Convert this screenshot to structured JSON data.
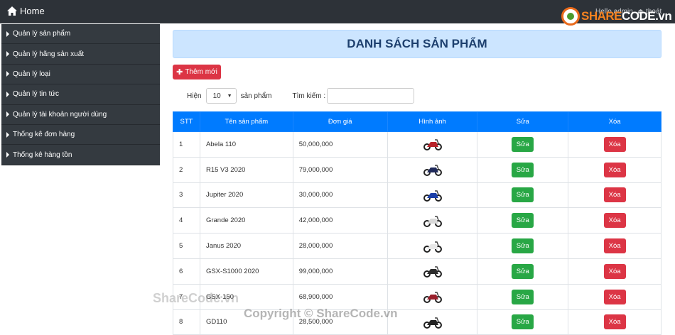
{
  "topbar": {
    "home_label": "Home",
    "greeting": "Hello admin",
    "logout_label": "thoát",
    "logo_text_a": "SHARE",
    "logo_text_b": "CODE",
    "logo_suffix": ".vn"
  },
  "sidebar": {
    "items": [
      {
        "label": "Quản lý sản phẩm"
      },
      {
        "label": "Quản lý hãng sản xuất"
      },
      {
        "label": "Quản lý loại"
      },
      {
        "label": "Quản lý tin tức"
      },
      {
        "label": "Quản lý tài khoản người dùng"
      },
      {
        "label": "Thống kê đơn hàng"
      },
      {
        "label": "Thống kê hàng tồn"
      }
    ]
  },
  "main": {
    "title": "DANH SÁCH SẢN PHẨM",
    "add_label": "Thêm mới",
    "show_label": "Hiện",
    "page_size": "10",
    "per_label": "sản phẩm",
    "search_label": "Tìm kiếm :",
    "search_value": ""
  },
  "table": {
    "headers": [
      "STT",
      "Tên sản phẩm",
      "Đơn giá",
      "Hình ảnh",
      "Sửa",
      "Xóa"
    ],
    "edit_label": "Sửa",
    "delete_label": "Xóa",
    "rows": [
      {
        "stt": "1",
        "name": "Abela 110",
        "price": "50,000,000",
        "color": "#b8232a"
      },
      {
        "stt": "2",
        "name": "R15 V3 2020",
        "price": "79,000,000",
        "color": "#1f2a5a"
      },
      {
        "stt": "3",
        "name": "Jupiter 2020",
        "price": "30,000,000",
        "color": "#1b3fa8"
      },
      {
        "stt": "4",
        "name": "Grande 2020",
        "price": "42,000,000",
        "color": "#d9d9d9"
      },
      {
        "stt": "5",
        "name": "Janus 2020",
        "price": "28,000,000",
        "color": "#e8e8e8"
      },
      {
        "stt": "6",
        "name": "GSX-S1000 2020",
        "price": "99,000,000",
        "color": "#2b2b2b"
      },
      {
        "stt": "7",
        "name": "GSX-150",
        "price": "68,900,000",
        "color": "#9a1f2b"
      },
      {
        "stt": "8",
        "name": "GD110",
        "price": "28,500,000",
        "color": "#222222"
      }
    ]
  },
  "watermark": {
    "line1": "ShareCode.vn",
    "line2": "Copyright © ShareCode.vn"
  }
}
